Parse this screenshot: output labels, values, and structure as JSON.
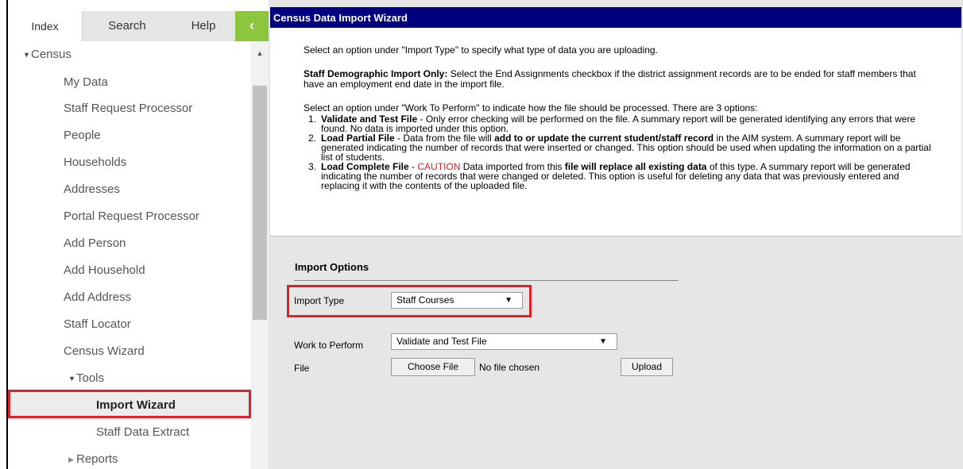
{
  "sidebar": {
    "tabs": [
      {
        "label": "Index"
      },
      {
        "label": "Search"
      },
      {
        "label": "Help"
      }
    ],
    "collapse_glyph": "‹",
    "tree": {
      "census": "Census",
      "items": [
        "My Data",
        "Staff Request Processor",
        "People",
        "Households",
        "Addresses",
        "Portal Request Processor",
        "Add Person",
        "Add Household",
        "Add Address",
        "Staff Locator",
        "Census Wizard"
      ],
      "tools": "Tools",
      "tools_items": [
        "Import Wizard",
        "Staff Data Extract"
      ],
      "reports": "Reports",
      "selected": "Import Wizard"
    }
  },
  "main": {
    "title": "Census Data Import Wizard",
    "instructions": {
      "para1": "Select an option under \"Import Type\" to specify what type of data you are uploading.",
      "para2_bold": "Staff Demographic Import Only:",
      "para2_rest": " Select the End Assignments checkbox if the district assignment records are to be ended for staff members that have an employment end date in the import file.",
      "para3": "Select an option under \"Work To Perform\" to indicate how the file should be processed. There are 3 options:",
      "option1": {
        "num": "1.",
        "bold": "Validate and Test File",
        "rest": " - Only error checking will be performed on the file. A summary report will be generated identifying any errors that were found. No data is imported under this option."
      },
      "option2": {
        "num": "2.",
        "bold": "Load Partial File",
        "rest1": " - Data from the file will ",
        "bold2": "add to or update the current student/staff record",
        "rest2": " in the AIM system. A summary report will be generated indicating the number of records that were inserted or changed. This option should be used when updating the information on a partial list of students."
      },
      "option3": {
        "num": "3.",
        "bold": "Load Complete File",
        "dash": " - ",
        "caution": "CAUTION",
        "rest1": " Data imported from this ",
        "bold2": "file will replace all existing data",
        "rest2": " of this type. A summary report will be generated indicating the number of records that were changed or deleted. This option is useful for deleting any data that was previously entered and replacing it with the contents of the uploaded file."
      }
    },
    "import_options": {
      "heading": "Import Options",
      "import_type_label": "Import Type",
      "import_type_value": "Staff Courses",
      "work_label": "Work to Perform",
      "work_value": "Validate and Test File",
      "file_label": "File",
      "choose_file_label": "Choose File",
      "no_file_text": "No file chosen",
      "upload_label": "Upload"
    }
  },
  "colors": {
    "title_bar": "#000080",
    "collapse_button": "#8cc63f",
    "highlight": "#e31e24",
    "caution": "#e31e24"
  },
  "icons": {
    "collapse": "chevron-left-icon",
    "expanded": "triangle-down-icon",
    "collapsed": "triangle-right-icon",
    "dropdown": "triangle-down-icon",
    "scroll_up": "triangle-up-icon"
  }
}
